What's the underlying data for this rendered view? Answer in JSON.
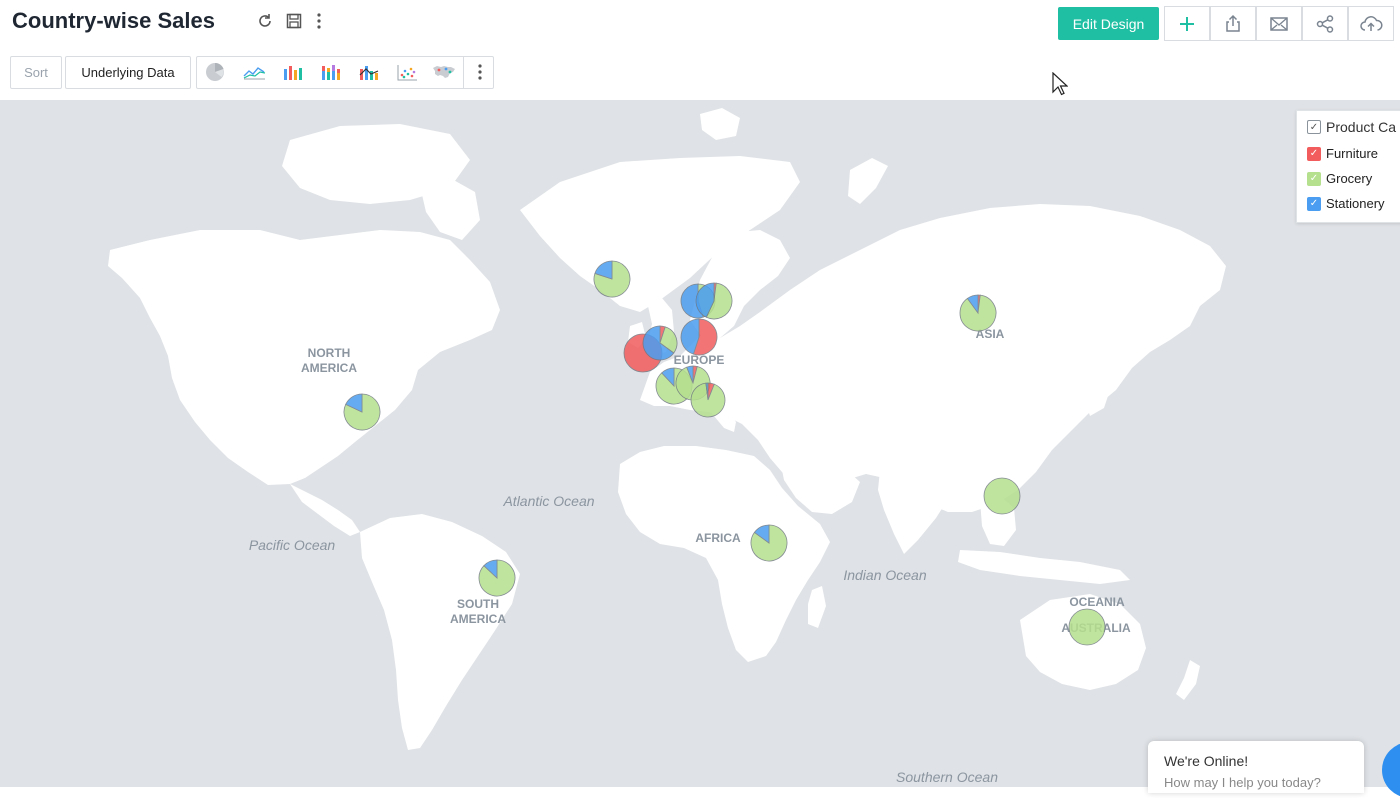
{
  "header": {
    "title": "Country-wise Sales",
    "edit_label": "Edit Design",
    "title_icons": [
      "refresh-icon",
      "save-icon",
      "more-vertical-icon"
    ],
    "action_icons": [
      "plus-icon",
      "export-icon",
      "email-icon",
      "share-icon",
      "cloud-upload-icon"
    ]
  },
  "toolbar": {
    "sort_label": "Sort",
    "underlying_label": "Underlying Data",
    "chart_types": [
      "pie-chart-icon",
      "line-chart-icon",
      "bar-chart-icon",
      "stacked-bar-chart-icon",
      "combo-bar-chart-icon",
      "scatter-chart-icon",
      "map-chart-icon"
    ]
  },
  "map": {
    "labels": {
      "north_america_1": "NORTH",
      "north_america_2": "AMERICA",
      "europe": "EUROPE",
      "asia": "ASIA",
      "africa": "AFRICA",
      "south_america_1": "SOUTH",
      "south_america_2": "AMERICA",
      "oceania": "OCEANIA",
      "australia": "AUSTRALIA",
      "atlantic": "Atlantic Ocean",
      "pacific": "Pacific Ocean",
      "indian": "Indian Ocean",
      "southern": "Southern Ocean"
    }
  },
  "legend": {
    "header": "Product Ca",
    "items": [
      {
        "label": "Furniture",
        "color": "#f25c5c"
      },
      {
        "label": "Grocery",
        "color": "#b5e08e"
      },
      {
        "label": "Stationery",
        "color": "#4a9df0"
      }
    ]
  },
  "chart_data": {
    "type": "pie-map",
    "series": [
      "Furniture",
      "Grocery",
      "Stationery"
    ],
    "colors": {
      "Furniture": "#f25c5c",
      "Grocery": "#b5e08e",
      "Stationery": "#4a9df0"
    },
    "points": [
      {
        "region": "North America",
        "values": {
          "Furniture": 0,
          "Grocery": 0.82,
          "Stationery": 0.18
        }
      },
      {
        "region": "South America",
        "values": {
          "Furniture": 0,
          "Grocery": 0.87,
          "Stationery": 0.13
        }
      },
      {
        "region": "Iceland",
        "values": {
          "Furniture": 0,
          "Grocery": 0.8,
          "Stationery": 0.2
        }
      },
      {
        "region": "Norway",
        "values": {
          "Furniture": 0,
          "Grocery": 0.45,
          "Stationery": 0.55
        }
      },
      {
        "region": "Sweden",
        "values": {
          "Furniture": 0.02,
          "Grocery": 0.55,
          "Stationery": 0.43
        }
      },
      {
        "region": "Ireland",
        "values": {
          "Furniture": 1.0,
          "Grocery": 0,
          "Stationery": 0
        }
      },
      {
        "region": "United Kingdom",
        "values": {
          "Furniture": 0.05,
          "Grocery": 0.3,
          "Stationery": 0.65
        }
      },
      {
        "region": "Germany",
        "values": {
          "Furniture": 0.55,
          "Grocery": 0,
          "Stationery": 0.45
        }
      },
      {
        "region": "France",
        "values": {
          "Furniture": 0,
          "Grocery": 0.88,
          "Stationery": 0.12
        }
      },
      {
        "region": "Switzerland",
        "values": {
          "Furniture": 0.04,
          "Grocery": 0.9,
          "Stationery": 0.06
        }
      },
      {
        "region": "Italy",
        "values": {
          "Furniture": 0.06,
          "Grocery": 0.92,
          "Stationery": 0.02
        }
      },
      {
        "region": "Russia",
        "values": {
          "Furniture": 0.02,
          "Grocery": 0.88,
          "Stationery": 0.1
        }
      },
      {
        "region": "Kenya",
        "values": {
          "Furniture": 0,
          "Grocery": 0.85,
          "Stationery": 0.15
        }
      },
      {
        "region": "Southeast Asia",
        "values": {
          "Furniture": 0,
          "Grocery": 1.0,
          "Stationery": 0
        }
      },
      {
        "region": "Australia",
        "values": {
          "Furniture": 0,
          "Grocery": 1.0,
          "Stationery": 0
        }
      }
    ]
  },
  "chat": {
    "line1": "We're Online!",
    "line2": "How may I help you today?"
  }
}
